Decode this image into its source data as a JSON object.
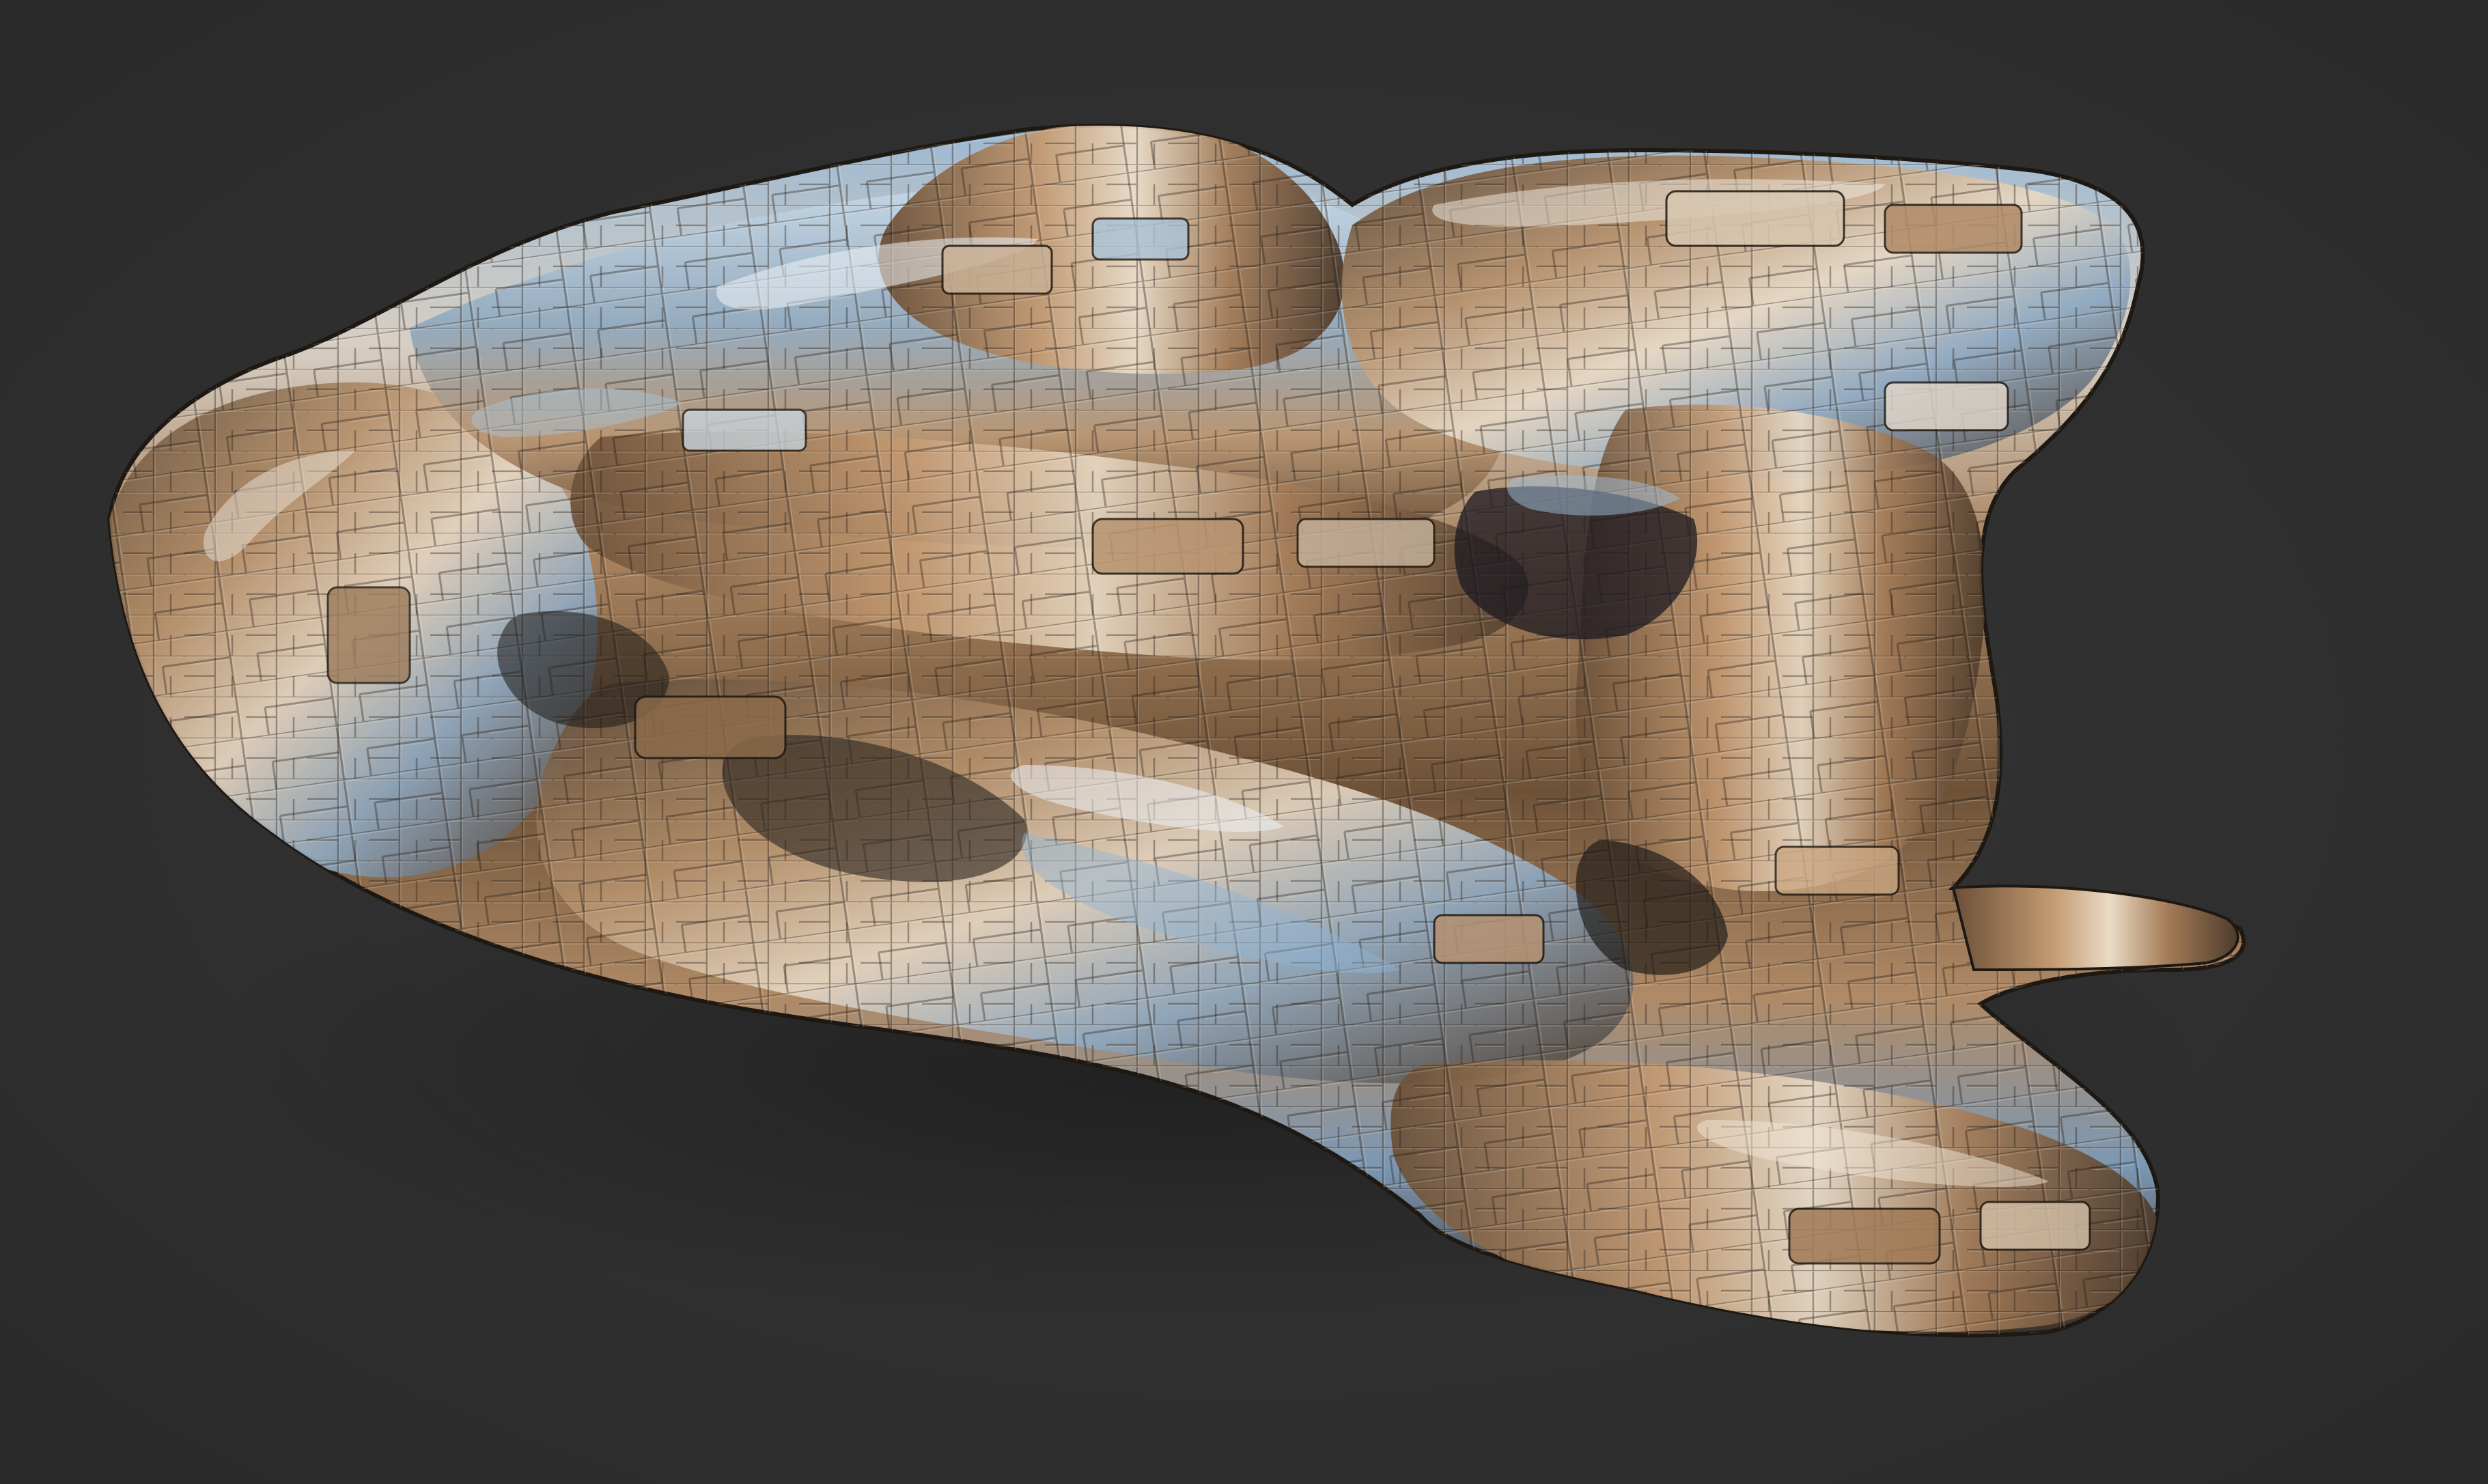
{
  "scene": {
    "background_color": "#303030",
    "subject": "spaceship-sculpt",
    "palette": {
      "hull_dark": "#3a2e22",
      "hull_bronze": "#8a6a4a",
      "hull_copper": "#b08660",
      "hull_highlight": "#e8d8c4",
      "hull_blue_reflect": "#7fa6c8",
      "hull_steel": "#5d6f80",
      "panel_shadow": "#1d1814"
    }
  }
}
